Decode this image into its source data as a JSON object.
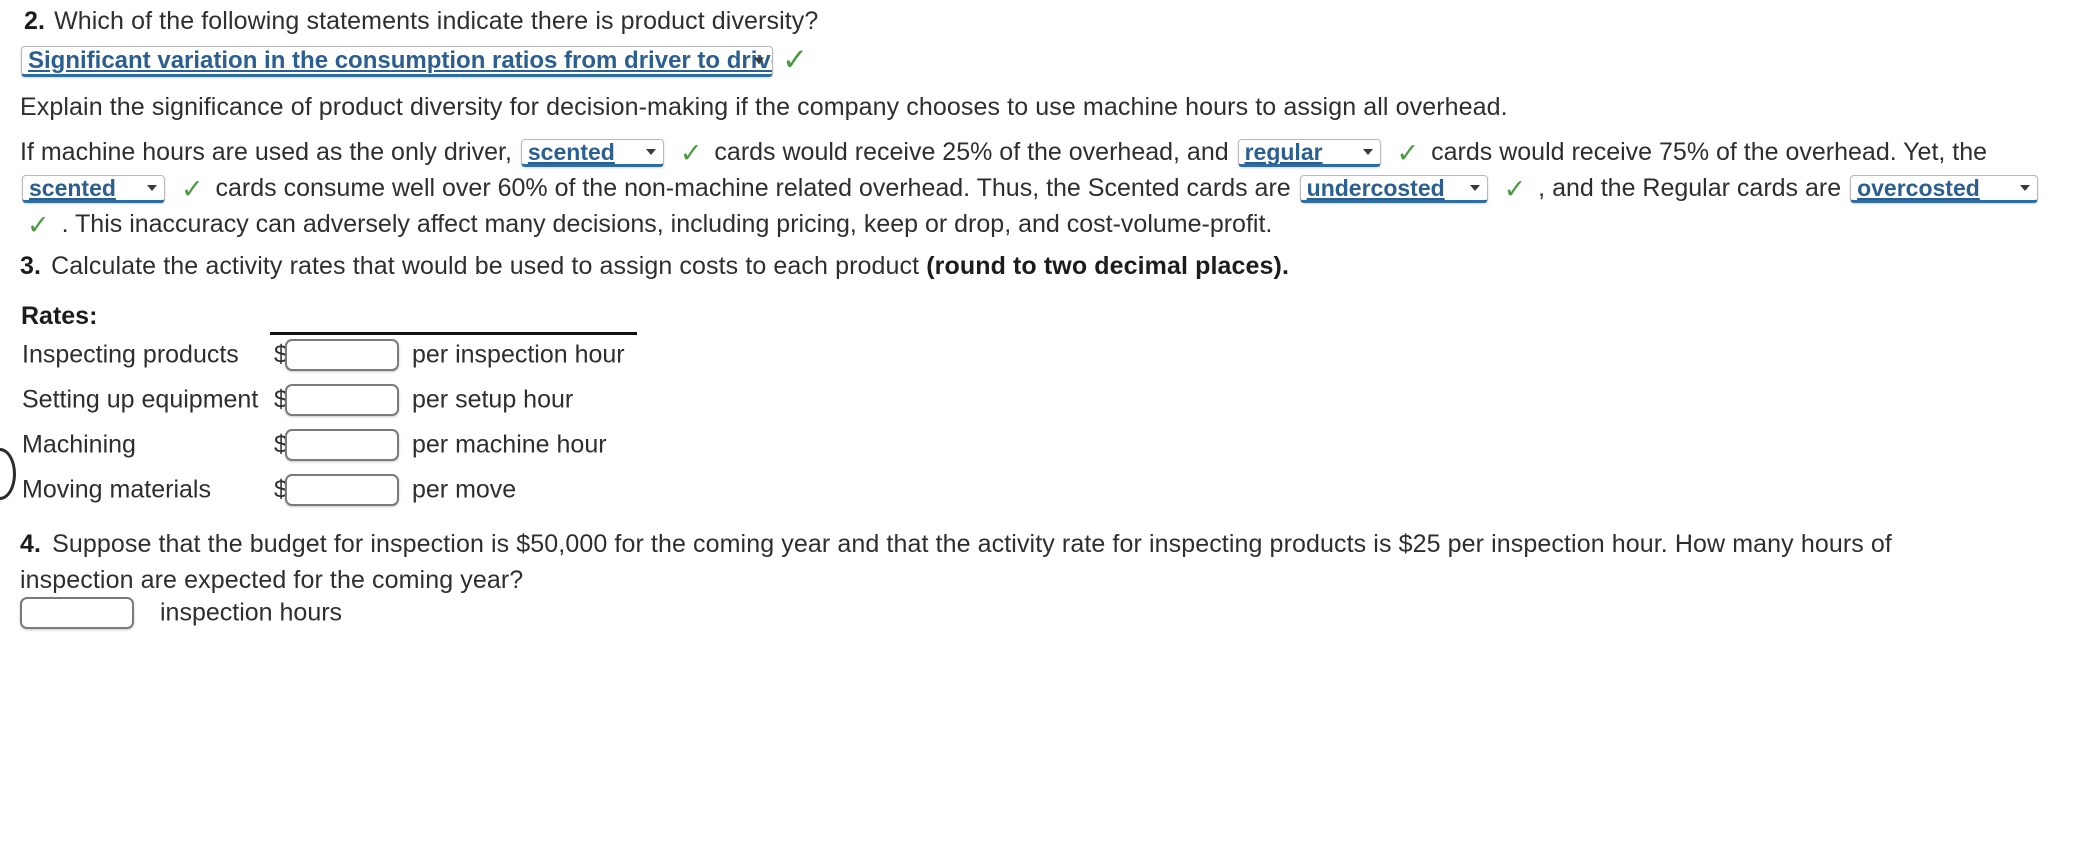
{
  "question2": {
    "number": "2.",
    "prompt": "Which of the following statements indicate there is product diversity?",
    "answer_select_value": "Significant variation in the consumption ratios from driver to driver.",
    "correct_mark": "✓"
  },
  "explanation": {
    "intro": "Explain the significance of product diversity for decision-making if the company chooses to use machine hours to assign all overhead.",
    "seg1": "If machine hours are used as the only driver,",
    "sel1": "scented",
    "seg2": "cards would receive 25% of the overhead, and",
    "sel2": "regular",
    "seg3": "cards would receive 75% of the overhead. Yet, the",
    "sel3": "scented",
    "seg4": "cards consume well over 60% of the non-machine related overhead. Thus, the Scented cards are",
    "sel4": "undercosted",
    "seg5": ", and the Regular cards are",
    "sel5": "overcosted",
    "seg6": ". This inaccuracy can adversely affect many decisions, including pricing, keep or drop, and cost-volume-profit.",
    "correct_mark": "✓"
  },
  "question3": {
    "number": "3.",
    "prompt_normal": "Calculate the activity rates that would be used to assign costs to each product ",
    "prompt_bold": "(round to two decimal places).",
    "section_label": "Rates:",
    "rows": [
      {
        "label": "Inspecting products",
        "currency": "$",
        "value": "",
        "unit": "per inspection hour"
      },
      {
        "label": "Setting up equipment",
        "currency": "$",
        "value": "",
        "unit": "per setup hour"
      },
      {
        "label": "Machining",
        "currency": "$",
        "value": "",
        "unit": "per machine hour"
      },
      {
        "label": "Moving materials",
        "currency": "$",
        "value": "",
        "unit": "per move"
      }
    ]
  },
  "question4": {
    "number": "4.",
    "prompt_line1": "Suppose that the budget for inspection is $50,000 for the coming year and that the activity rate for inspecting products is $25 per inspection hour. How many hours of",
    "prompt_line2": "inspection are expected for the coming year?",
    "answer_value": "",
    "answer_unit": "inspection hours"
  },
  "colors": {
    "select_text": "#2b5f92",
    "select_underline": "#2e6da4",
    "check_green": "#4a9b42",
    "body_text": "#2e2e2e",
    "input_border": "#7b7b7b",
    "rule": "#111111"
  }
}
